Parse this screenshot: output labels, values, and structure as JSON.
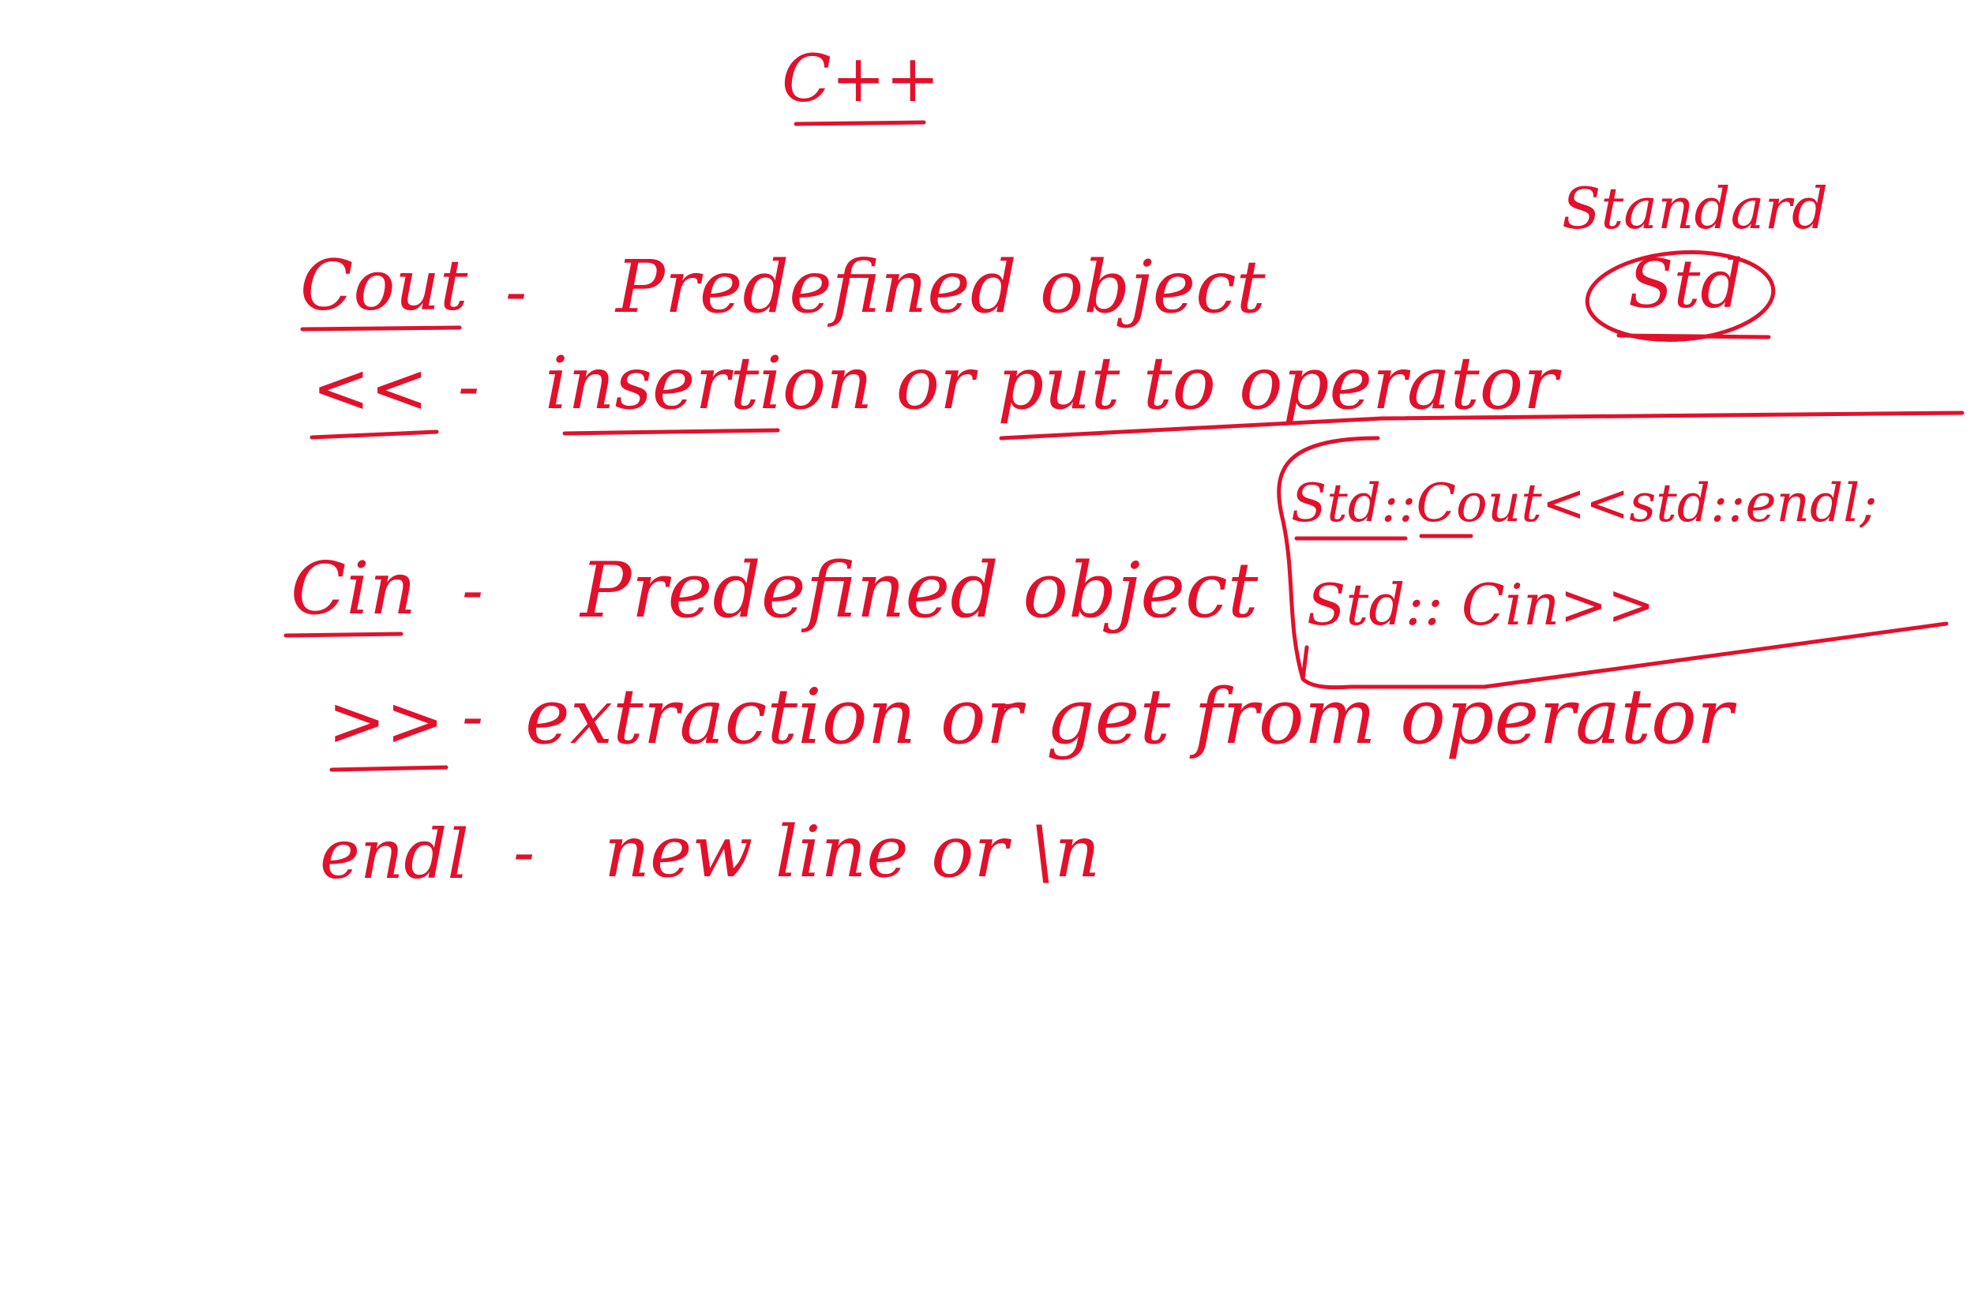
{
  "ink_color": "#e3102c",
  "notes": {
    "title": "C++",
    "cout_term": "Cout",
    "cout_dash": "-",
    "cout_desc": "Predefined object",
    "insertion_op": "<<",
    "insertion_dash": "-",
    "insertion_desc": "insertion or put to operator",
    "cin_term": "Cin",
    "cin_dash": "-",
    "cin_desc": "Predefined object",
    "extraction_op": ">>",
    "extraction_dash": "-",
    "extraction_desc": "extraction or get from operator",
    "endl_term": "endl",
    "endl_dash": "-",
    "endl_desc": "new line or \\n",
    "standard_label": "Standard",
    "std_label": "Std",
    "code_line_1": "Std::Cout<<std::endl;",
    "code_line_2": "Std:: Cin>>"
  }
}
